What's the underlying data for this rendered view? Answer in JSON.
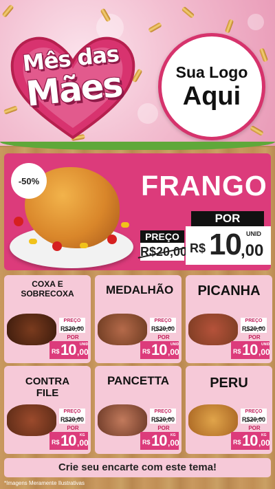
{
  "header": {
    "title_line1": "Mês das",
    "title_line2": "Mães",
    "logo_line1": "Sua Logo",
    "logo_line2": "Aqui"
  },
  "featured": {
    "discount": "-50%",
    "name": "FRANGO",
    "preco_label": "PREÇO",
    "old_price": "R$20,00",
    "por_label": "POR",
    "rs": "R$",
    "price_int": "10",
    "price_cents": ",00",
    "unit": "UNID"
  },
  "products": [
    {
      "name": "COXA E SOBRECOXA",
      "preco_label": "PREÇO",
      "old_price": "R$20,00",
      "por_label": "POR",
      "rs": "R$",
      "price_int": "10",
      "price_cents": ",00",
      "unit": "UNID"
    },
    {
      "name": "MEDALHÃO",
      "preco_label": "PREÇO",
      "old_price": "R$20,00",
      "por_label": "POR",
      "rs": "R$",
      "price_int": "10",
      "price_cents": ",00",
      "unit": "UNID"
    },
    {
      "name": "PICANHA",
      "preco_label": "PREÇO",
      "old_price": "R$20,00",
      "por_label": "POR",
      "rs": "R$",
      "price_int": "10",
      "price_cents": ",00",
      "unit": "UNID"
    },
    {
      "name": "CONTRA FILE",
      "preco_label": "PREÇO",
      "old_price": "R$20,00",
      "por_label": "POR",
      "rs": "R$",
      "price_int": "10",
      "price_cents": ",00",
      "unit": "KG"
    },
    {
      "name": "PANCETTA",
      "preco_label": "PREÇO",
      "old_price": "R$20,00",
      "por_label": "POR",
      "rs": "R$",
      "price_int": "10",
      "price_cents": ",00",
      "unit": "KG"
    },
    {
      "name": "PERU",
      "preco_label": "PREÇO",
      "old_price": "R$20,00",
      "por_label": "POR",
      "rs": "R$",
      "price_int": "10",
      "price_cents": ",00",
      "unit": "KG"
    }
  ],
  "footer": {
    "banner": "Crie seu encarte com este tema!",
    "disclaimer": "*Imagens Meramente Ilustrativas"
  },
  "colors": {
    "brand_pink": "#dc3b7b",
    "card_pink": "#f6c9d8",
    "wood": "#c9995f"
  }
}
